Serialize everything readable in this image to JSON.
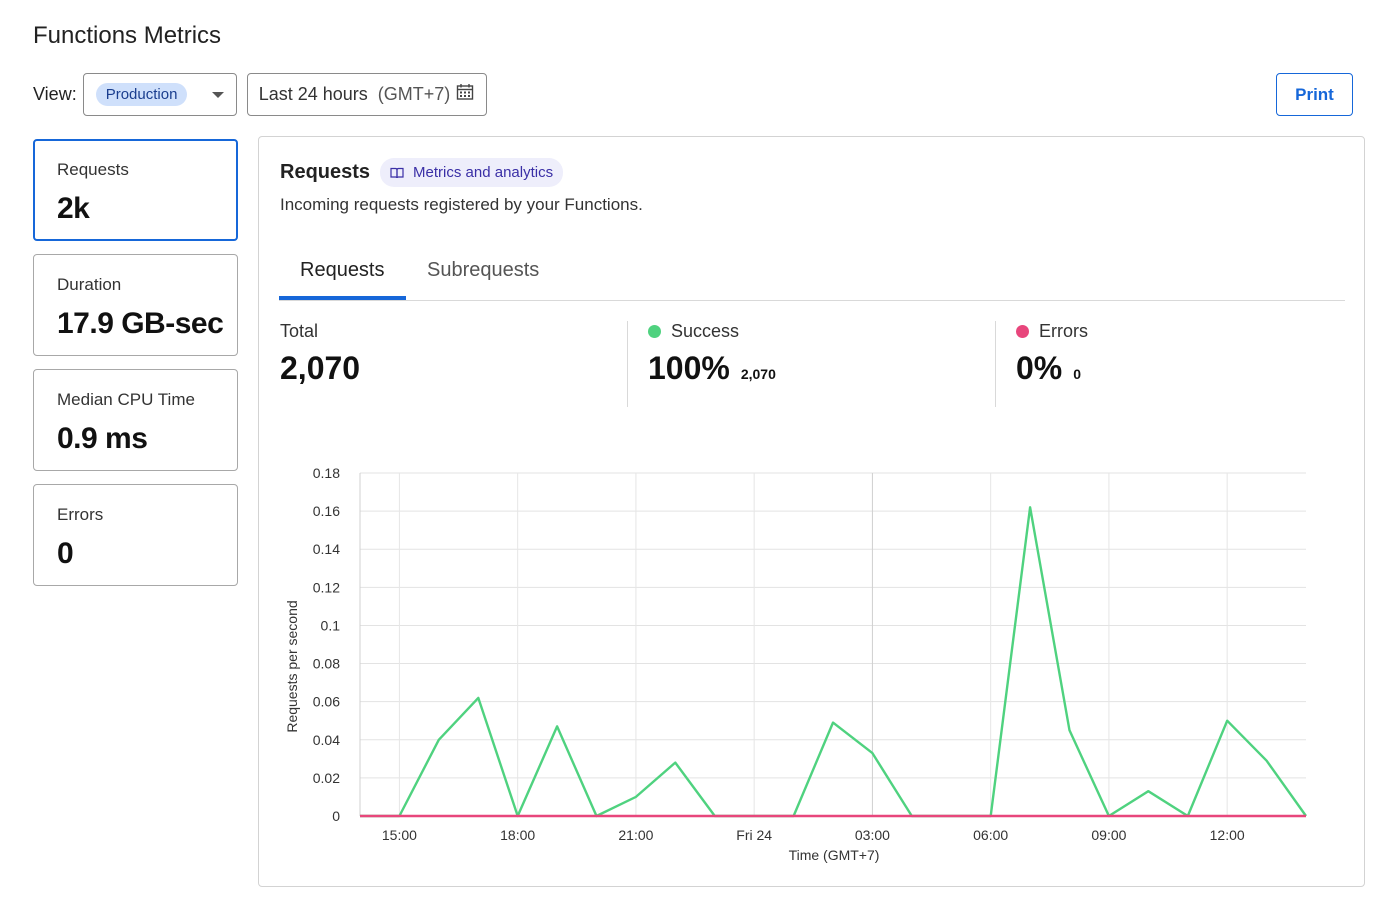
{
  "page": {
    "title": "Functions Metrics"
  },
  "toolbar": {
    "view_label": "View:",
    "environment": "Production",
    "range_label": "Last 24 hours",
    "range_timezone": "(GMT+7)",
    "print_label": "Print"
  },
  "metric_cards": [
    {
      "label": "Requests",
      "value": "2k"
    },
    {
      "label": "Duration",
      "value": "17.9 GB-sec"
    },
    {
      "label": "Median CPU Time",
      "value": "0.9 ms"
    },
    {
      "label": "Errors",
      "value": "0"
    }
  ],
  "panel": {
    "title": "Requests",
    "docs_link": "Metrics and analytics",
    "description": "Incoming requests registered by your Functions.",
    "tabs": [
      "Requests",
      "Subrequests"
    ],
    "stats": {
      "total_label": "Total",
      "total_value": "2,070",
      "success_label": "Success",
      "success_value": "100%",
      "success_count": "2,070",
      "errors_label": "Errors",
      "errors_value": "0%",
      "errors_count": "0"
    }
  },
  "colors": {
    "accent": "#1667d9",
    "success": "#4fd27f",
    "errors": "#e8467c"
  },
  "chart_data": {
    "type": "line",
    "title": "",
    "xlabel": "Time (GMT+7)",
    "ylabel": "Requests per second",
    "ylim": [
      0,
      0.18
    ],
    "y_ticks": [
      "0",
      "0.02",
      "0.04",
      "0.06",
      "0.08",
      "0.1",
      "0.12",
      "0.14",
      "0.16",
      "0.18"
    ],
    "x_tick_labels": [
      "15:00",
      "18:00",
      "21:00",
      "Fri 24",
      "03:00",
      "06:00",
      "09:00",
      "12:00"
    ],
    "x_tick_hours": [
      15,
      18,
      21,
      24,
      27,
      30,
      33,
      36
    ],
    "xlim_hours": [
      14,
      38
    ],
    "series": [
      {
        "name": "Success",
        "color": "#4fd27f",
        "x_hours": [
          14,
          15,
          16,
          17,
          18,
          19,
          20,
          21,
          22,
          23,
          24,
          25,
          26,
          27,
          28,
          29,
          30,
          31,
          32,
          33,
          34,
          35,
          36,
          37,
          38
        ],
        "values": [
          0,
          0,
          0.04,
          0.062,
          0,
          0.047,
          0,
          0.01,
          0.028,
          0,
          0,
          0,
          0.049,
          0.033,
          0,
          0,
          0,
          0.162,
          0.045,
          0,
          0.013,
          0,
          0.05,
          0.029,
          0
        ]
      },
      {
        "name": "Errors",
        "color": "#e8467c",
        "x_hours": [
          14,
          38
        ],
        "values": [
          0,
          0
        ]
      }
    ]
  }
}
